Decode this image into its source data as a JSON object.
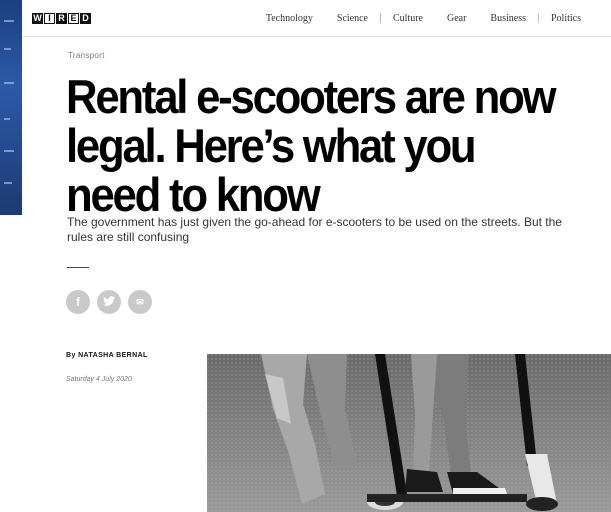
{
  "header": {
    "logo_letters": [
      "W",
      "I",
      "R",
      "E",
      "D"
    ],
    "nav": [
      "Technology",
      "Science",
      "Culture",
      "Gear",
      "Business",
      "Politics"
    ]
  },
  "article": {
    "section": "Transport",
    "headline": "Rental e-scooters are now legal. Here’s what you need to know",
    "dek": "The government has just given the go-ahead for e-scooters to be used on the streets. But the rules are still confusing",
    "byline": "By NATASHA BERNAL",
    "date": "Saturday 4 July 2020"
  },
  "share": {
    "facebook_glyph": "f",
    "twitter_glyph": "t",
    "email_glyph": "✉"
  },
  "colors": {
    "share_icon_bg": "#c9c9c9",
    "left_background": "#2c5aa8"
  },
  "hero_image": {
    "icon": "photo-icon"
  }
}
